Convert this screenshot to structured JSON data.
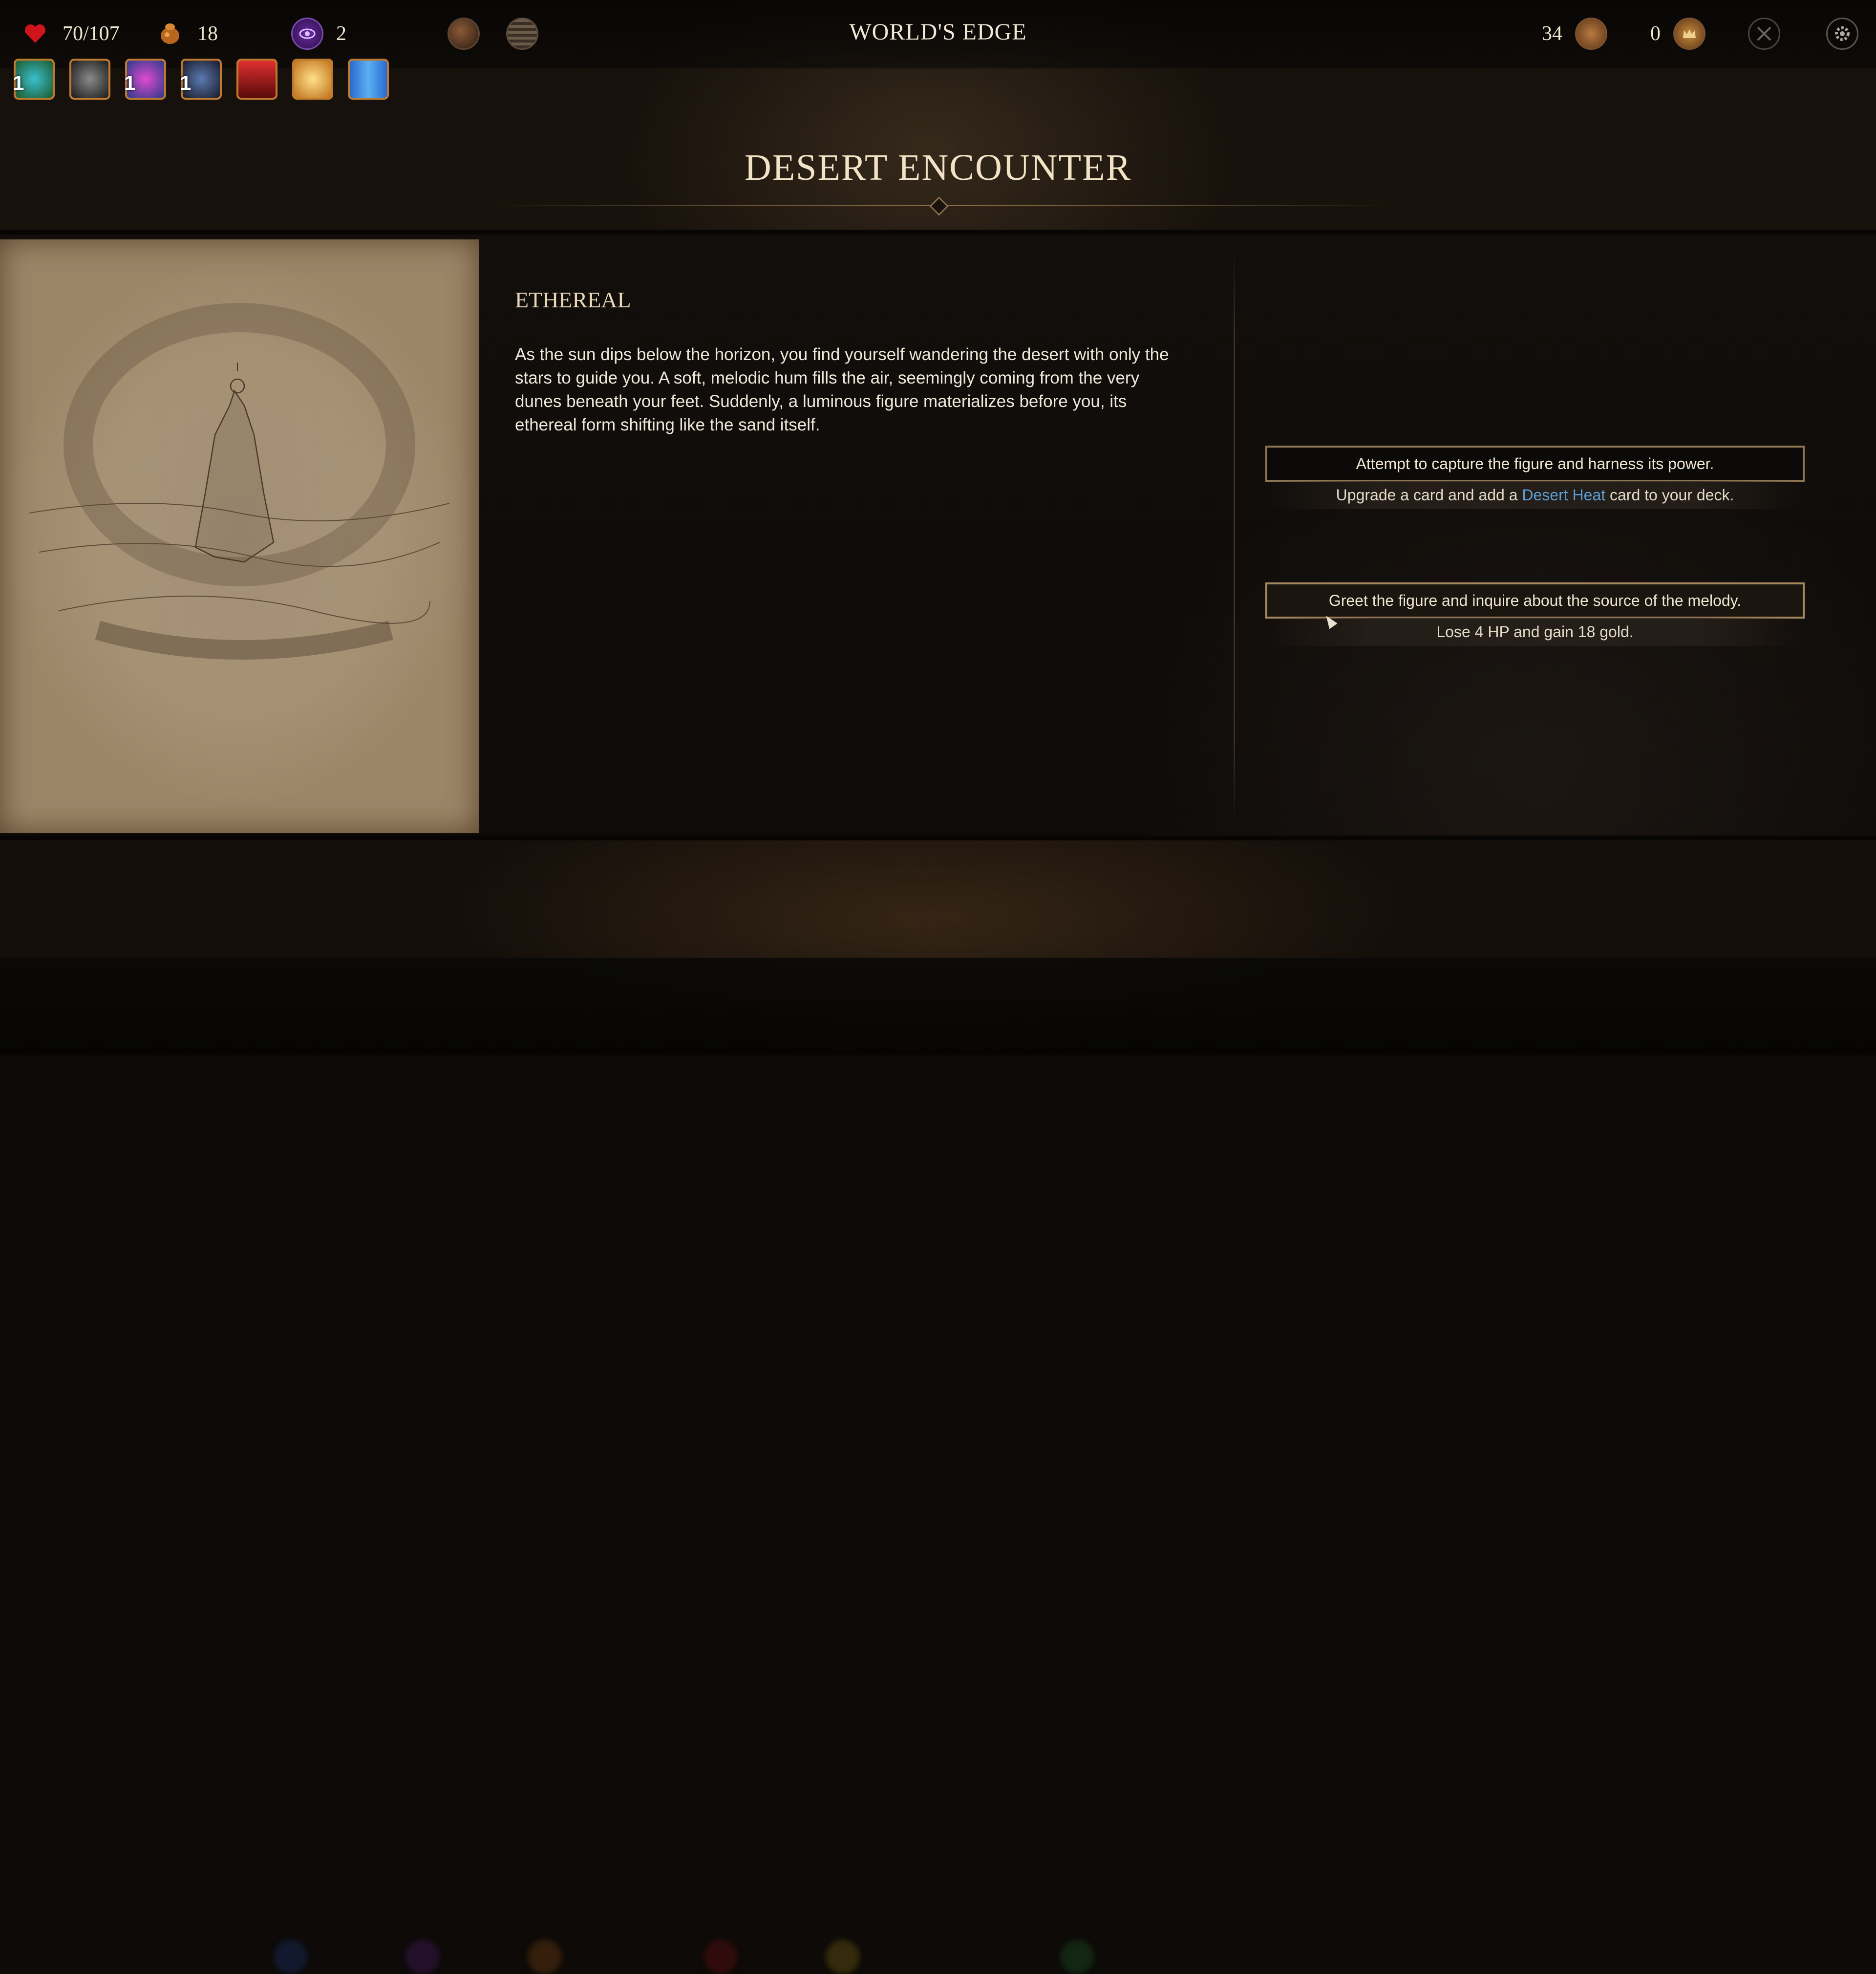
{
  "topbar": {
    "hp": "70/107",
    "gold": "18",
    "potions": "2",
    "world_title": "WORLD'S EDGE",
    "cards": "34",
    "crowns": "0"
  },
  "icons": {
    "hp": "heart-icon",
    "gold": "gold-pouch-icon",
    "potion": "purple-eye-potion-icon",
    "map": "map-orb-icon",
    "deck": "deck-stack-icon",
    "cards": "card-pile-icon",
    "crown": "crown-icon",
    "close": "close-icon",
    "settings": "gear-icon"
  },
  "relics": [
    {
      "name": "globe-relic-icon",
      "count": "1"
    },
    {
      "name": "dark-orb-relic-icon",
      "count": ""
    },
    {
      "name": "star-sigil-relic-icon",
      "count": "1"
    },
    {
      "name": "winged-beast-relic-icon",
      "count": "1"
    },
    {
      "name": "ruby-crystal-relic-icon",
      "count": ""
    },
    {
      "name": "golden-sun-relic-icon",
      "count": ""
    },
    {
      "name": "blue-book-relic-icon",
      "count": ""
    }
  ],
  "encounter": {
    "title": "DESERT ENCOUNTER",
    "subtitle": "ETHEREAL",
    "body": "As the sun dips below the horizon, you find yourself wandering the desert with only the stars to guide you. A soft, melodic hum fills the air, seemingly coming from the very dunes beneath your feet. Suddenly, a luminous figure materializes before you, its ethereal form shifting like the sand itself."
  },
  "choices": [
    {
      "label": "Attempt to capture the figure and harness its power.",
      "effect_pre": "Upgrade a card and add a ",
      "effect_keyword": "Desert Heat",
      "effect_post": " card to your deck."
    },
    {
      "label": "Greet the figure and inquire about the source of the melody.",
      "effect": "Lose 4 HP and gain 18 gold."
    }
  ],
  "colors": {
    "accent_border": "#8f7553",
    "keyword": "#5b9fd6",
    "relic_border": "#c07a2e"
  }
}
